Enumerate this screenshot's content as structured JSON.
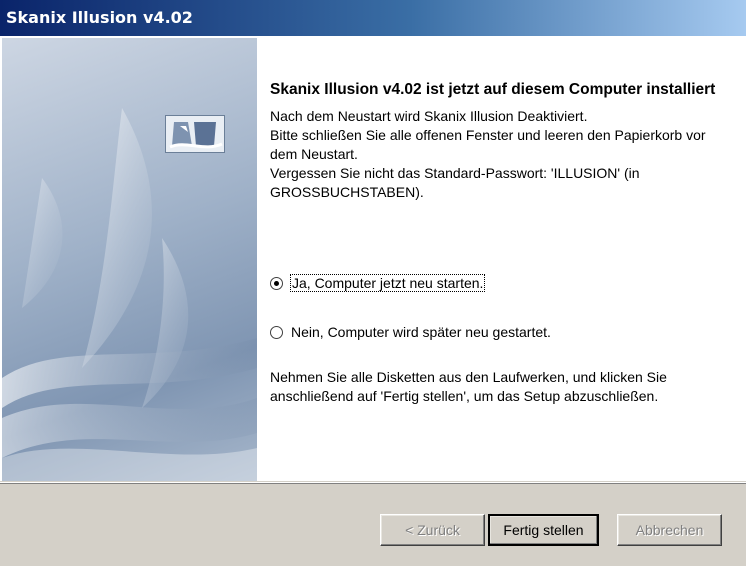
{
  "window": {
    "title": "Skanix Illusion v4.02"
  },
  "content": {
    "heading": "Skanix Illusion v4.02 ist jetzt auf diesem Computer installiert",
    "para1": "Nach dem Neustart wird Skanix Illusion  Deaktiviert.\nBitte schließen Sie alle offenen Fenster und leeren den Papierkorb vor dem Neustart.\nVergessen Sie nicht das Standard-Passwort: 'ILLUSION' (in GROSSBUCHSTABEN).",
    "para2": "Nehmen Sie alle Disketten aus den Laufwerken, und klicken Sie anschließend auf 'Fertig stellen', um das Setup abzuschließen."
  },
  "options": {
    "restart_now": {
      "label": "Ja, Computer jetzt neu starten.",
      "selected": true
    },
    "restart_later": {
      "label": "Nein, Computer wird später neu gestartet.",
      "selected": false
    }
  },
  "buttons": {
    "back": "< Zurück",
    "finish": "Fertig stellen",
    "cancel": "Abbrechen"
  }
}
